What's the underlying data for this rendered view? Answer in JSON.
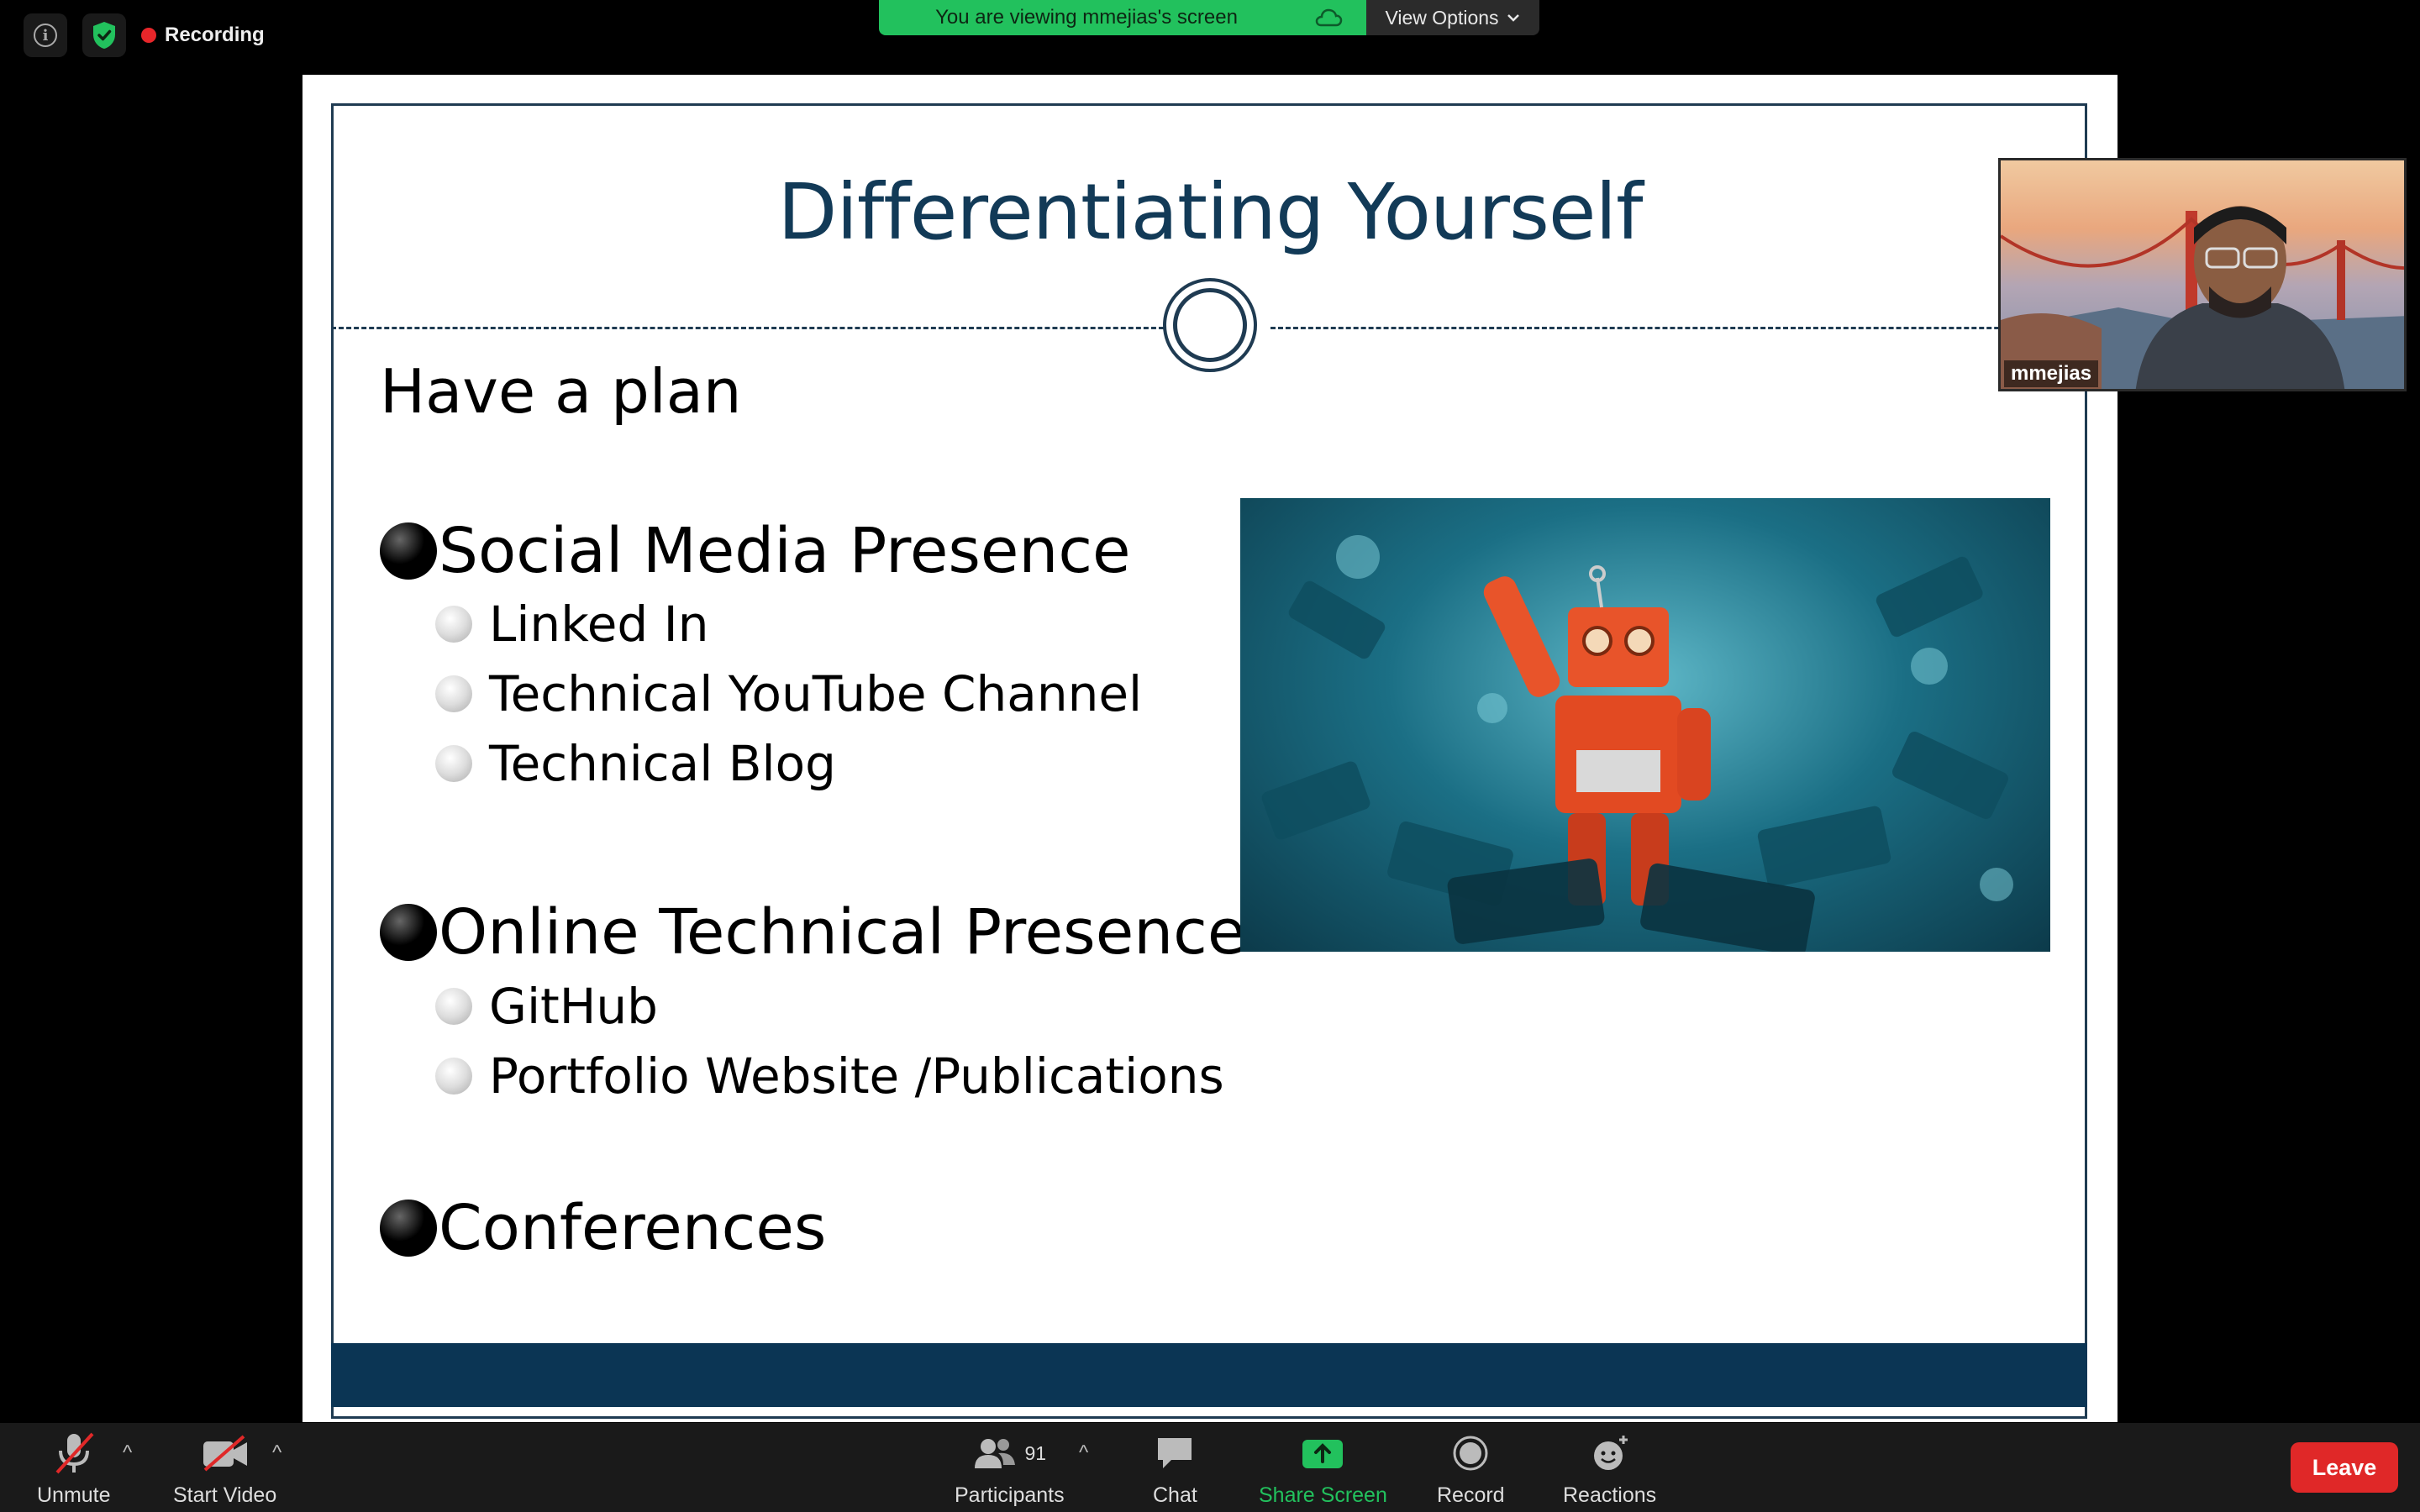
{
  "top": {
    "info_icon": "info-icon",
    "security_icon": "shield-check-icon",
    "recording_label": "Recording",
    "banner_text": "You are viewing mmejias's screen",
    "view_options_label": "View Options"
  },
  "slide": {
    "title": "Differentiating Yourself",
    "subtitle": "Have a plan",
    "sections": [
      {
        "label": "Social Media Presence",
        "items": [
          "Linked In",
          "Technical YouTube Channel",
          "Technical Blog"
        ]
      },
      {
        "label": "Online Technical Presence",
        "items": [
          "GitHub",
          "Portfolio Website /Publications"
        ]
      },
      {
        "label": "Conferences",
        "items": []
      }
    ]
  },
  "self_view": {
    "name": "mmejias"
  },
  "toolbar": {
    "unmute_label": "Unmute",
    "start_video_label": "Start Video",
    "participants_label": "Participants",
    "participants_count": "91",
    "chat_label": "Chat",
    "share_screen_label": "Share Screen",
    "record_label": "Record",
    "reactions_label": "Reactions",
    "leave_label": "Leave"
  },
  "colors": {
    "banner_green": "#22c15d",
    "slide_navy": "#0b3554",
    "leave_red": "#e02828",
    "share_green": "#22c15d"
  }
}
